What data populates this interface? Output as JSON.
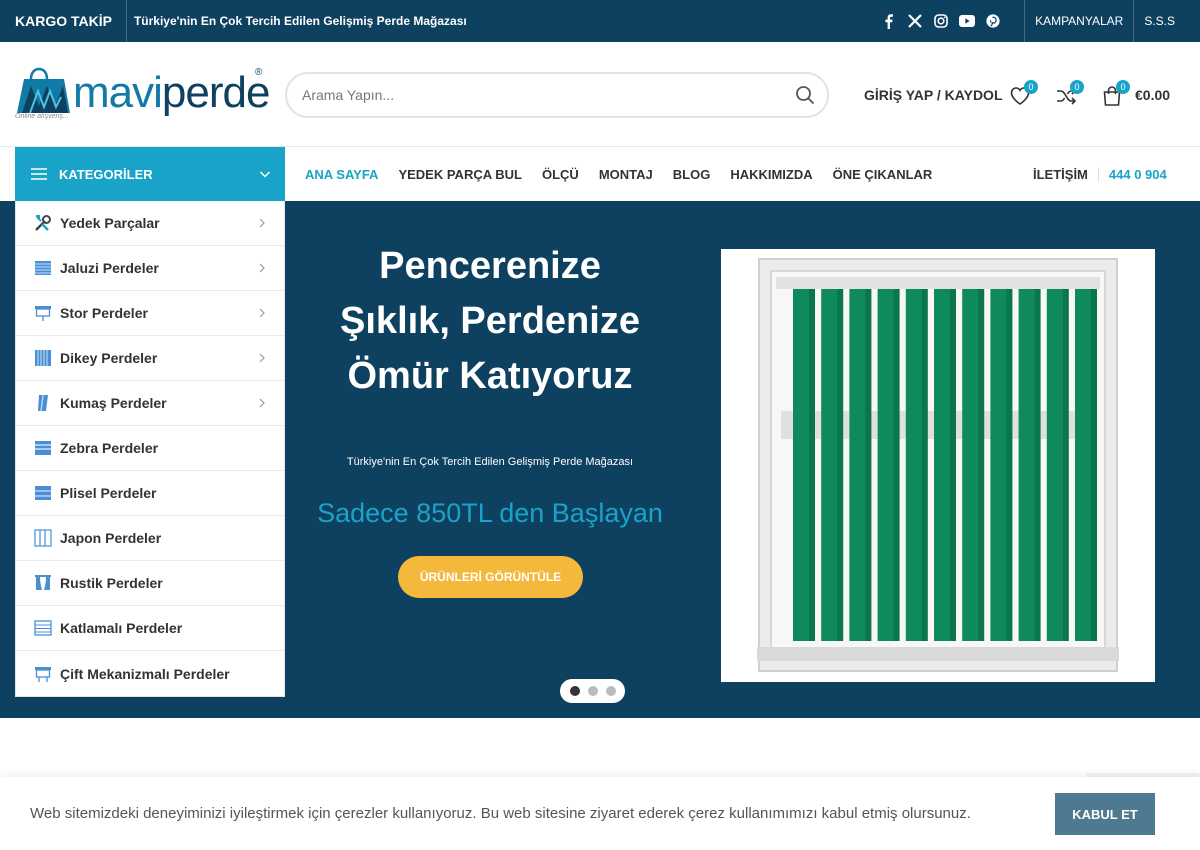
{
  "topbar": {
    "kargo": "KARGO TAKİP",
    "tagline": "Türkiye'nin En Çok Tercih Edilen Gelişmiş Perde Mağazası",
    "socials": [
      "facebook-icon",
      "x-icon",
      "instagram-icon",
      "youtube-icon",
      "pinterest-icon"
    ],
    "links": [
      "KAMPANYALAR",
      "S.S.S"
    ]
  },
  "header": {
    "logo_text_1": "mavi",
    "logo_text_2": "perde",
    "logo_sub": "Online alışveriş...",
    "logo_reg": "®",
    "search_placeholder": "Arama Yapın...",
    "login": "GİRİŞ YAP / KAYDOL",
    "wishlist_count": "0",
    "compare_count": "0",
    "cart_count": "0",
    "cart_total": "€0.00"
  },
  "nav": {
    "categories_label": "KATEGORİLER",
    "menu": [
      "ANA SAYFA",
      "YEDEK PARÇA BUL",
      "ÖLÇÜ",
      "MONTAJ",
      "BLOG",
      "HAKKIMIZDA",
      "ÖNE ÇIKANLAR"
    ],
    "contact_label": "İLETİŞİM",
    "phone": "444 0 904"
  },
  "sidebar": {
    "items": [
      {
        "label": "Yedek Parçalar",
        "icon": "tools-icon",
        "has_sub": true
      },
      {
        "label": "Jaluzi Perdeler",
        "icon": "venetian-blind-icon",
        "has_sub": true
      },
      {
        "label": "Stor Perdeler",
        "icon": "roller-blind-icon",
        "has_sub": true
      },
      {
        "label": "Dikey Perdeler",
        "icon": "vertical-blind-icon",
        "has_sub": true
      },
      {
        "label": "Kumaş Perdeler",
        "icon": "fabric-curtain-icon",
        "has_sub": true
      },
      {
        "label": "Zebra Perdeler",
        "icon": "zebra-blind-icon",
        "has_sub": false
      },
      {
        "label": "Plisel Perdeler",
        "icon": "pleated-blind-icon",
        "has_sub": false
      },
      {
        "label": "Japon Perdeler",
        "icon": "japanese-panel-icon",
        "has_sub": false
      },
      {
        "label": "Rustik Perdeler",
        "icon": "rustic-curtain-icon",
        "has_sub": false
      },
      {
        "label": "Katlamalı Perdeler",
        "icon": "folding-blind-icon",
        "has_sub": false
      },
      {
        "label": "Çift Mekanizmalı Perdeler",
        "icon": "double-roller-icon",
        "has_sub": false
      }
    ]
  },
  "hero": {
    "headline_1": "Pencerenize",
    "headline_2": "Şıklık, Perdenize",
    "headline_3": "Ömür Katıyoruz",
    "subtitle": "Türkiye'nin En Çok Tercih Edilen Gelişmiş Perde Mağazası",
    "price": "Sadece 850TL den Başlayan",
    "cta": "ÜRÜNLERİ GÖRÜNTÜLE",
    "slide_count": 3,
    "active_slide": 1,
    "colors": {
      "background": "#0e4160",
      "accent": "#1aa3c8",
      "cta": "#f4b93a",
      "blind": "#0e8a5c"
    }
  },
  "cookie": {
    "text": "Web sitemizdeki deneyiminizi iyileştirmek için çerezler kullanıyoruz. Bu web sitesine ziyaret ederek çerez kullanımımızı kabul etmiş olursunuz.",
    "accept": "KABUL ET"
  }
}
